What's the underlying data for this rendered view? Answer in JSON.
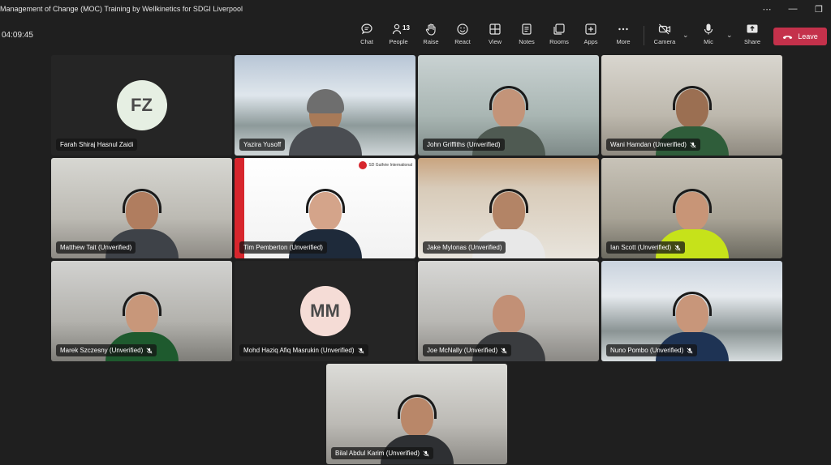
{
  "window": {
    "title": "Management of Change (MOC) Training by Wellkinetics for SDGI Liverpool",
    "controls": {
      "more": "⋯",
      "minimize": "—",
      "restore": "❐"
    }
  },
  "toolbar": {
    "timer": "04:09:45",
    "items": [
      {
        "id": "chat",
        "label": "Chat"
      },
      {
        "id": "people",
        "label": "People",
        "count": "13"
      },
      {
        "id": "raise",
        "label": "Raise"
      },
      {
        "id": "react",
        "label": "React"
      },
      {
        "id": "view",
        "label": "View"
      },
      {
        "id": "notes",
        "label": "Notes"
      },
      {
        "id": "rooms",
        "label": "Rooms"
      },
      {
        "id": "apps",
        "label": "Apps"
      },
      {
        "id": "more",
        "label": "More"
      },
      {
        "id": "camera",
        "label": "Camera"
      },
      {
        "id": "mic",
        "label": "Mic"
      },
      {
        "id": "share",
        "label": "Share"
      }
    ],
    "leave_label": "Leave",
    "leave_color": "#c4314b"
  },
  "participants": [
    {
      "name": "Farah Shiraj Hasnul Zaidi",
      "initials": "FZ",
      "muted": false,
      "video": false
    },
    {
      "name": "Yazira Yusoff",
      "muted": false,
      "video": true
    },
    {
      "name": "John Griffiths (Unverified)",
      "muted": false,
      "video": true
    },
    {
      "name": "Wani Hamdan (Unverified)",
      "muted": true,
      "video": true
    },
    {
      "name": "Matthew Tait (Unverified)",
      "muted": false,
      "video": true
    },
    {
      "name": "Tim Pemberton (Unverified)",
      "muted": false,
      "video": true,
      "background_logo": "SD Guthrie International"
    },
    {
      "name": "Jake Mylonas (Unverified)",
      "muted": false,
      "video": true
    },
    {
      "name": "Ian Scott (Unverified)",
      "muted": true,
      "video": true
    },
    {
      "name": "Marek Szczesny (Unverified)",
      "muted": true,
      "video": true
    },
    {
      "name": "Mohd Haziq Afiq Masrukin (Unverified)",
      "initials": "MM",
      "muted": true,
      "video": false
    },
    {
      "name": "Joe McNally (Unverified)",
      "muted": true,
      "video": true
    },
    {
      "name": "Nuno Pombo (Unverified)",
      "muted": true,
      "video": true
    },
    {
      "name": "Bilal Abdul Karim (Unverified)",
      "muted": true,
      "video": true
    }
  ]
}
